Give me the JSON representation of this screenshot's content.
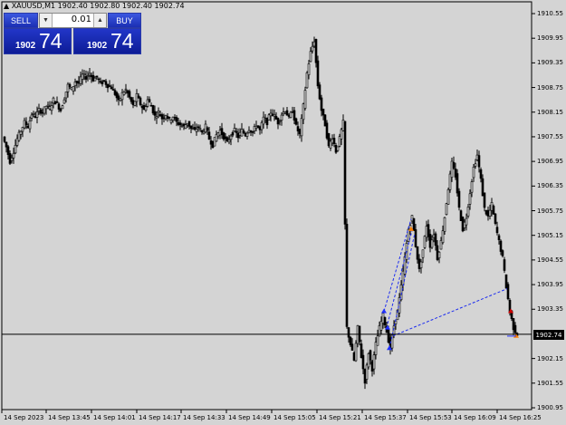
{
  "window": {
    "title": "XAUUSD,M1  1902.40 1902.80 1902.40 1902.74",
    "menu_icon": "triangle-up-icon"
  },
  "trade_panel": {
    "sell_label": "SELL",
    "buy_label": "BUY",
    "lot": "0.01",
    "sell_price_small": "1902",
    "sell_price_big": "74",
    "buy_price_small": "1902",
    "buy_price_big": "74",
    "colors": {
      "button": "#1b2fb3",
      "price_bg": "#0d1c96"
    }
  },
  "current_price": "1902.74",
  "chart_data": {
    "type": "candlestick",
    "symbol": "XAUUSD",
    "timeframe": "M1",
    "ylim": [
      1900.95,
      1910.65
    ],
    "y_ticks": [
      "1910.55",
      "1909.95",
      "1909.35",
      "1908.75",
      "1908.15",
      "1907.55",
      "1906.95",
      "1906.35",
      "1905.75",
      "1905.15",
      "1904.55",
      "1903.95",
      "1903.35",
      "1902.74",
      "1902.15",
      "1901.55",
      "1900.95"
    ],
    "x_ticks": [
      "14 Sep 2023",
      "14 Sep 13:45",
      "14 Sep 14:01",
      "14 Sep 14:17",
      "14 Sep 14:33",
      "14 Sep 14:49",
      "14 Sep 15:05",
      "14 Sep 15:21",
      "14 Sep 15:37",
      "14 Sep 15:53",
      "14 Sep 16:09",
      "14 Sep 16:25"
    ],
    "grid": false,
    "current_line": 1902.74,
    "close_path": [
      [
        0,
        1907.55
      ],
      [
        4,
        1907.3
      ],
      [
        8,
        1906.95
      ],
      [
        12,
        1907.2
      ],
      [
        16,
        1907.5
      ],
      [
        20,
        1907.7
      ],
      [
        24,
        1907.9
      ],
      [
        28,
        1907.8
      ],
      [
        32,
        1908.1
      ],
      [
        36,
        1908.05
      ],
      [
        40,
        1908.2
      ],
      [
        44,
        1908.15
      ],
      [
        48,
        1908.3
      ],
      [
        52,
        1908.25
      ],
      [
        56,
        1908.45
      ],
      [
        60,
        1908.35
      ],
      [
        64,
        1908.2
      ],
      [
        68,
        1908.5
      ],
      [
        72,
        1908.8
      ],
      [
        76,
        1908.7
      ],
      [
        80,
        1908.9
      ],
      [
        84,
        1908.85
      ],
      [
        88,
        1909.05
      ],
      [
        92,
        1909.0
      ],
      [
        96,
        1909.1
      ],
      [
        100,
        1908.95
      ],
      [
        104,
        1909.0
      ],
      [
        108,
        1908.85
      ],
      [
        112,
        1908.9
      ],
      [
        116,
        1908.8
      ],
      [
        120,
        1908.75
      ],
      [
        124,
        1908.6
      ],
      [
        128,
        1908.4
      ],
      [
        132,
        1908.6
      ],
      [
        136,
        1908.7
      ],
      [
        140,
        1908.5
      ],
      [
        144,
        1908.3
      ],
      [
        148,
        1908.55
      ],
      [
        152,
        1908.35
      ],
      [
        156,
        1908.2
      ],
      [
        160,
        1908.45
      ],
      [
        164,
        1908.3
      ],
      [
        168,
        1908.05
      ],
      [
        172,
        1908.15
      ],
      [
        176,
        1908.0
      ],
      [
        180,
        1908.1
      ],
      [
        184,
        1907.95
      ],
      [
        188,
        1908.05
      ],
      [
        192,
        1907.9
      ],
      [
        196,
        1907.85
      ],
      [
        200,
        1907.8
      ],
      [
        204,
        1907.9
      ],
      [
        208,
        1907.75
      ],
      [
        212,
        1907.7
      ],
      [
        216,
        1907.8
      ],
      [
        220,
        1907.65
      ],
      [
        224,
        1907.8
      ],
      [
        228,
        1907.5
      ],
      [
        232,
        1907.35
      ],
      [
        236,
        1907.6
      ],
      [
        240,
        1907.7
      ],
      [
        244,
        1907.55
      ],
      [
        248,
        1907.4
      ],
      [
        252,
        1907.6
      ],
      [
        256,
        1907.7
      ],
      [
        260,
        1907.55
      ],
      [
        264,
        1907.7
      ],
      [
        268,
        1907.6
      ],
      [
        272,
        1907.75
      ],
      [
        276,
        1907.65
      ],
      [
        280,
        1907.85
      ],
      [
        284,
        1907.7
      ],
      [
        288,
        1908.0
      ],
      [
        292,
        1907.9
      ],
      [
        296,
        1908.15
      ],
      [
        300,
        1908.05
      ],
      [
        304,
        1907.9
      ],
      [
        308,
        1908.1
      ],
      [
        312,
        1908.2
      ],
      [
        316,
        1908.0
      ],
      [
        320,
        1908.2
      ],
      [
        324,
        1907.8
      ],
      [
        328,
        1907.6
      ],
      [
        332,
        1908.3
      ],
      [
        336,
        1909.1
      ],
      [
        340,
        1909.6
      ],
      [
        344,
        1909.9
      ],
      [
        348,
        1908.8
      ],
      [
        352,
        1908.2
      ],
      [
        356,
        1907.85
      ],
      [
        360,
        1907.3
      ],
      [
        364,
        1907.55
      ],
      [
        368,
        1907.2
      ],
      [
        372,
        1907.5
      ],
      [
        376,
        1907.9
      ],
      [
        380,
        1902.9
      ],
      [
        384,
        1902.5
      ],
      [
        388,
        1902.1
      ],
      [
        392,
        1902.9
      ],
      [
        396,
        1902.2
      ],
      [
        400,
        1901.6
      ],
      [
        404,
        1902.3
      ],
      [
        408,
        1901.9
      ],
      [
        412,
        1902.5
      ],
      [
        416,
        1902.9
      ],
      [
        420,
        1903.2
      ],
      [
        424,
        1902.8
      ],
      [
        428,
        1902.4
      ],
      [
        432,
        1902.95
      ],
      [
        436,
        1903.3
      ],
      [
        440,
        1903.9
      ],
      [
        444,
        1904.6
      ],
      [
        448,
        1905.3
      ],
      [
        452,
        1905.6
      ],
      [
        456,
        1904.9
      ],
      [
        460,
        1904.3
      ],
      [
        464,
        1904.8
      ],
      [
        468,
        1905.4
      ],
      [
        472,
        1904.9
      ],
      [
        476,
        1905.2
      ],
      [
        480,
        1904.6
      ],
      [
        484,
        1905.0
      ],
      [
        488,
        1905.6
      ],
      [
        492,
        1906.3
      ],
      [
        496,
        1906.9
      ],
      [
        500,
        1906.6
      ],
      [
        504,
        1905.8
      ],
      [
        508,
        1905.3
      ],
      [
        512,
        1905.6
      ],
      [
        516,
        1906.2
      ],
      [
        520,
        1906.8
      ],
      [
        524,
        1907.1
      ],
      [
        528,
        1906.5
      ],
      [
        532,
        1905.8
      ],
      [
        536,
        1905.6
      ],
      [
        540,
        1905.9
      ],
      [
        544,
        1905.4
      ],
      [
        548,
        1905.0
      ],
      [
        552,
        1904.6
      ],
      [
        556,
        1903.9
      ],
      [
        560,
        1903.3
      ],
      [
        564,
        1902.9
      ],
      [
        568,
        1902.74
      ]
    ],
    "trade_markers": [
      {
        "type": "open",
        "x": 420,
        "price": 1903.3,
        "color": "#2030ff"
      },
      {
        "type": "open",
        "x": 424,
        "price": 1902.9,
        "color": "#2030ff"
      },
      {
        "type": "open",
        "x": 426,
        "price": 1902.4,
        "color": "#2030ff"
      },
      {
        "type": "close",
        "x": 450,
        "price": 1905.3,
        "color": "#ff8000"
      },
      {
        "type": "close",
        "x": 560,
        "price": 1903.3,
        "color": "#d00000"
      },
      {
        "type": "close",
        "x": 566,
        "price": 1902.7,
        "color": "#ff8000"
      }
    ],
    "trade_lines": [
      {
        "x1": 420,
        "p1": 1903.3,
        "x2": 450,
        "p2": 1905.55
      },
      {
        "x1": 424,
        "p1": 1903.0,
        "x2": 452,
        "p2": 1905.35
      },
      {
        "x1": 426,
        "p1": 1902.4,
        "x2": 454,
        "p2": 1905.2
      },
      {
        "x1": 430,
        "p1": 1902.7,
        "x2": 556,
        "p2": 1903.85
      }
    ]
  }
}
